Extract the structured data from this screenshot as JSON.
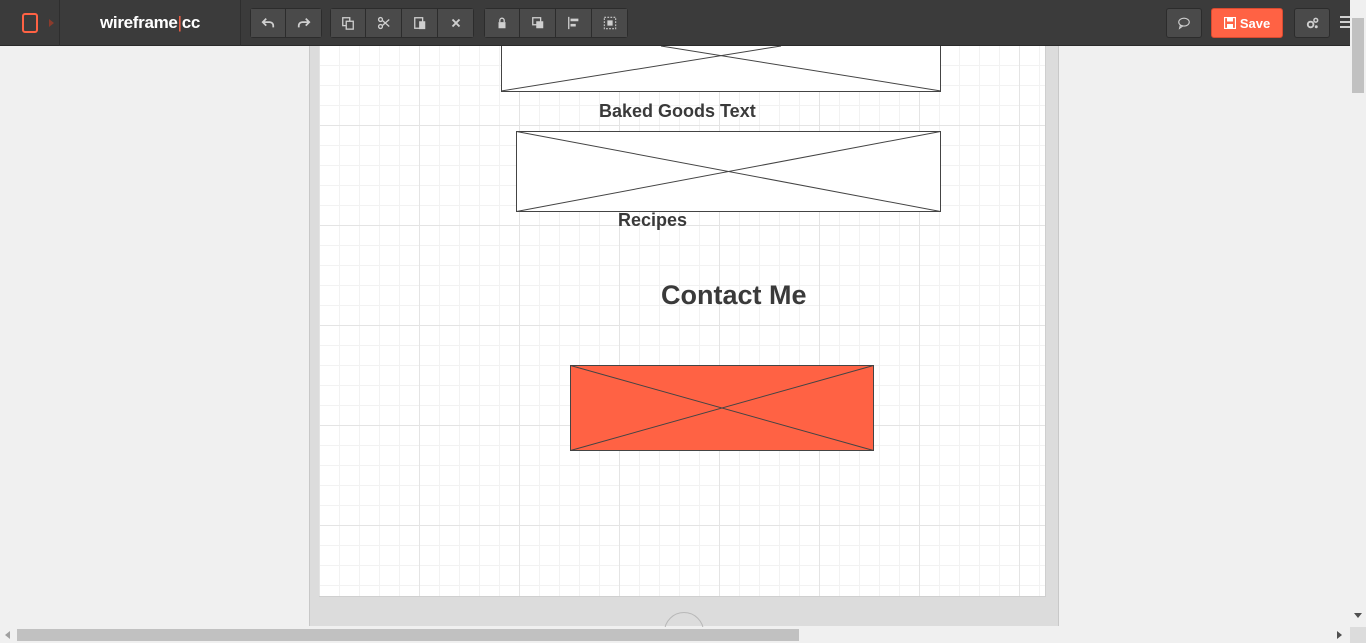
{
  "app": {
    "logo_left": "wireframe",
    "logo_sep": "|",
    "logo_right": "cc"
  },
  "toolbar": {
    "device_icon": "tablet-icon",
    "history": [
      {
        "icon": "undo-icon"
      },
      {
        "icon": "redo-icon"
      }
    ],
    "edit": [
      {
        "icon": "copy-icon"
      },
      {
        "icon": "cut-icon"
      },
      {
        "icon": "paste-icon"
      },
      {
        "icon": "delete-icon"
      }
    ],
    "arrange": [
      {
        "icon": "lock-icon"
      },
      {
        "icon": "bring-front-icon"
      },
      {
        "icon": "align-icon"
      },
      {
        "icon": "group-icon"
      }
    ],
    "comment_icon": "comment-icon",
    "save_label": "Save",
    "save_icon": "floppy-icon",
    "settings_icon": "settings-icon",
    "menu_icon": "menu-icon",
    "accent_color": "#ff6244"
  },
  "canvas": {
    "labels": {
      "baked_goods": "Baked Goods Text",
      "recipes": "Recipes",
      "contact": "Contact Me"
    },
    "placeholder_colors": {
      "image": "#ffffff",
      "contact_button": "#ff6244"
    }
  }
}
